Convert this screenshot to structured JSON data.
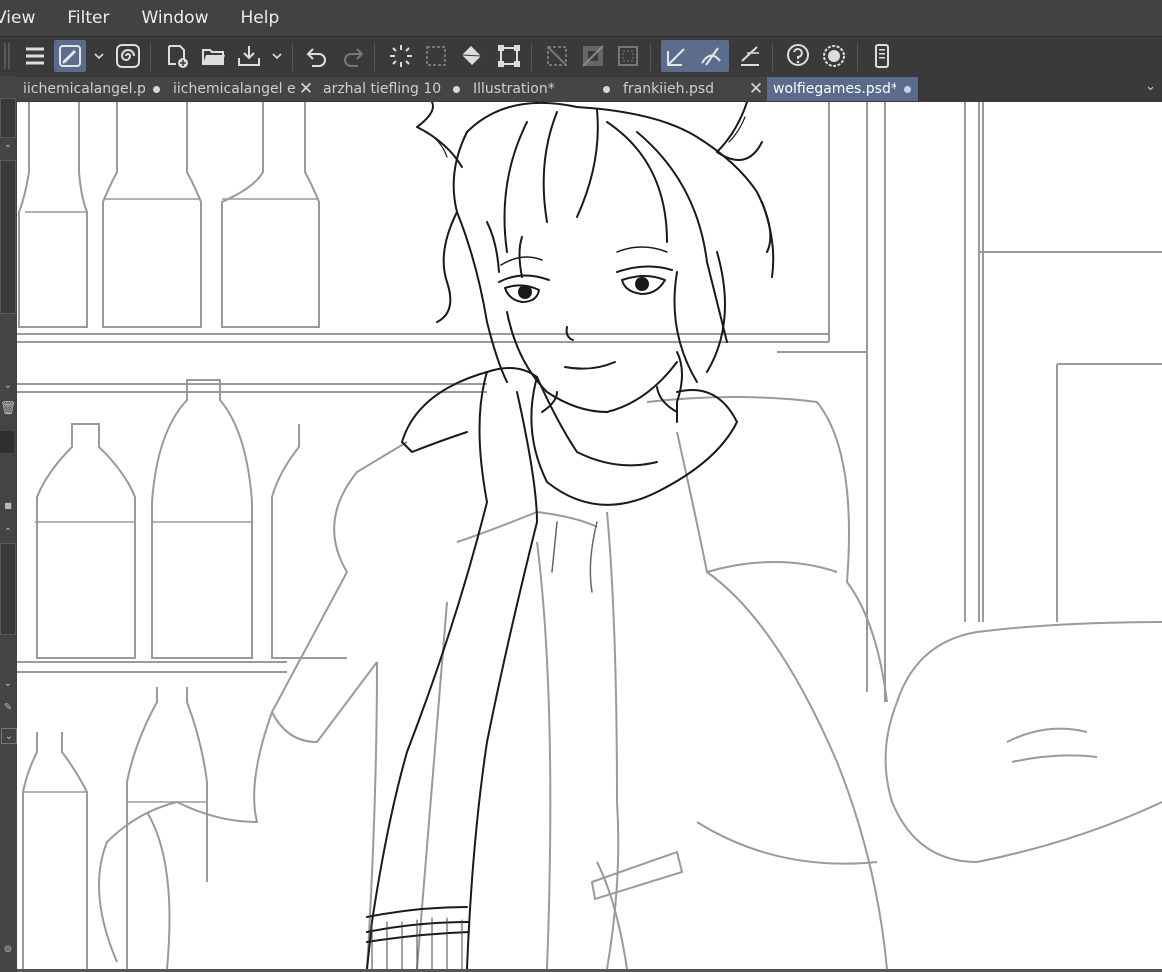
{
  "menu": {
    "items": [
      "View",
      "Filter",
      "Window",
      "Help"
    ]
  },
  "toolbar": {
    "buttons": [
      "menu-icon",
      "brush-settings-icon",
      "dropdown-icon",
      "spiral-icon",
      "new-canvas-icon",
      "open-folder-icon",
      "export-icon",
      "dropdown-icon",
      "undo-icon",
      "redo-icon",
      "select-all-icon",
      "deselect-icon",
      "fill-icon",
      "transform-icon",
      "clear-icon",
      "clear-outside-icon",
      "select-icon",
      "snap-ruler-icon",
      "snap-special-ruler-icon",
      "snap-grid-icon",
      "help-icon",
      "settings-icon",
      "device-icon"
    ]
  },
  "tabs": [
    {
      "label": "iichemicalangel.p",
      "marker": "dot",
      "active": false
    },
    {
      "label": "iichemicalangel e",
      "marker": "close",
      "active": false
    },
    {
      "label": "arzhal tiefling 10",
      "marker": "dot",
      "active": false
    },
    {
      "label": "Illustration*",
      "marker": "dot",
      "active": false
    },
    {
      "label": "frankiieh.psd",
      "marker": "close",
      "active": false
    },
    {
      "label": "wolfiegames.psd*",
      "marker": "dot",
      "active": true
    }
  ],
  "colors": {
    "menubar": "#424242",
    "toolbar": "#3a3a3a",
    "active_tab": "#5a6b8c",
    "canvas": "#ffffff",
    "lineart": "#1a1a1a",
    "background_lines": "#9a9a9a"
  }
}
